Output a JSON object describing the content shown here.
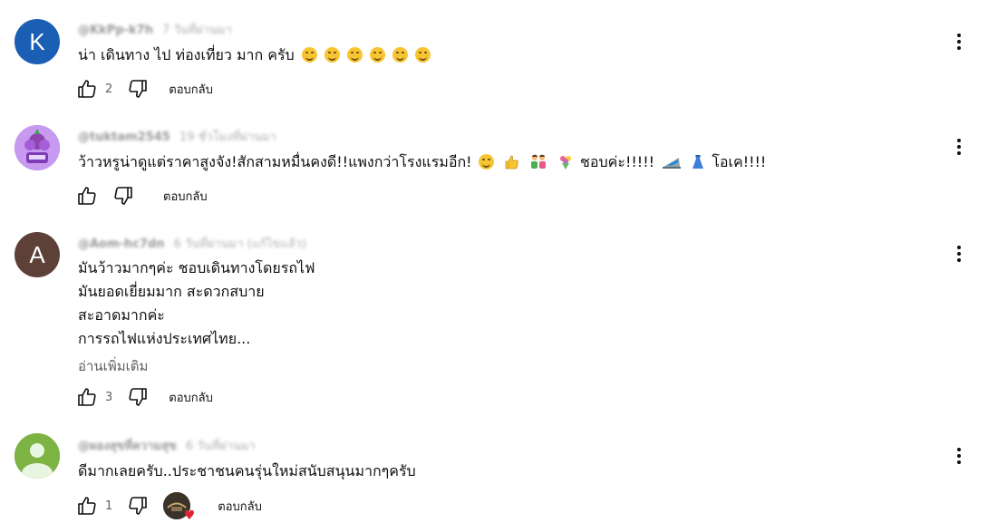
{
  "comments": [
    {
      "avatar_letter": "K",
      "avatar_color": "#1a5fb4",
      "handle": "@KkPp-k7h",
      "time": "7 วันที่ผ่านมา",
      "text": "น่า เดินทาง ไป ท่องเที่ยว มาก ครับ",
      "emojis": [
        "smile",
        "smile",
        "smile",
        "smile",
        "smile",
        "smile"
      ],
      "likes": "2",
      "reply_label": "ตอบกลับ"
    },
    {
      "avatar_letter": "",
      "avatar_color": "#9b59d6",
      "handle": "@tuktam2545",
      "time": "19 ชั่วโมงที่ผ่านมา",
      "text": "ว้าวหรูน่าดูแต่ราคาสูงจัง!สักสามหมื่นคงดี!!แพงกว่าโรงแรมอีก!",
      "text_tail1": "ชอบค่ะ!!!!!",
      "text_tail2": "โอเค!!!!",
      "likes": "",
      "reply_label": "ตอบกลับ"
    },
    {
      "avatar_letter": "A",
      "avatar_color": "#5d4037",
      "handle": "@Aom-hc7dn",
      "time": "6 วันที่ผ่านมา (แก้ไขแล้ว)",
      "lines": [
        "มันว้าวมากๆค่ะ ชอบเดินทางโดยรถไฟ",
        "มันยอดเยี่ยมมาก สะดวกสบาย",
        "สะอาดมากค่ะ",
        "การรถไฟแห่งประเทศไทย..."
      ],
      "read_more": "อ่านเพิ่มเติม",
      "likes": "3",
      "reply_label": "ตอบกลับ"
    },
    {
      "avatar_letter": "",
      "avatar_color": "#7cb342",
      "handle": "@ผองสุขที่ความสุข",
      "time": "6 วันที่ผ่านมา",
      "text": "ดีมากเลยครับ..ประชาชนคนรุ่นใหม่สนับสนุนมากๆครับ",
      "likes": "1",
      "reply_label": "ตอบกลับ"
    }
  ]
}
